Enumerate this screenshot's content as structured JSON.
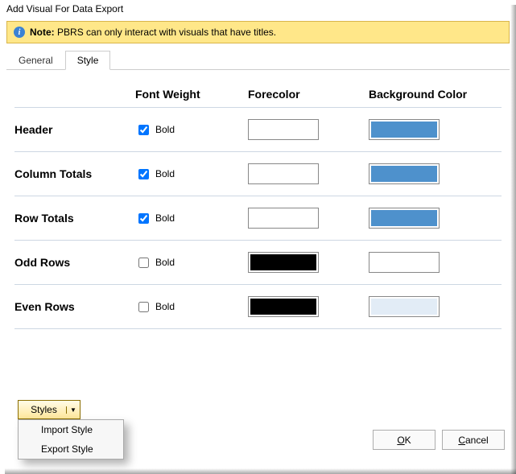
{
  "title": "Add Visual For Data Export",
  "note_label": "Note:",
  "note_text": "PBRS can only interact with visuals that have titles.",
  "tabs": {
    "general": "General",
    "style": "Style"
  },
  "headers": {
    "font_weight": "Font Weight",
    "forecolor": "Forecolor",
    "bgcolor": "Background Color"
  },
  "bold_label": "Bold",
  "rows": [
    {
      "label": "Header",
      "bold": true,
      "fore": "#ffffff",
      "bg": "#4e91cc"
    },
    {
      "label": "Column Totals",
      "bold": true,
      "fore": "#ffffff",
      "bg": "#4e91cc"
    },
    {
      "label": "Row Totals",
      "bold": true,
      "fore": "#ffffff",
      "bg": "#4e91cc"
    },
    {
      "label": "Odd Rows",
      "bold": false,
      "fore": "#000000",
      "bg": "#ffffff"
    },
    {
      "label": "Even Rows",
      "bold": false,
      "fore": "#000000",
      "bg": "#e2ecf6"
    }
  ],
  "styles_btn": "Styles",
  "menu": {
    "import": "Import Style",
    "export": "Export Style"
  },
  "buttons": {
    "ok": "OK",
    "cancel": "Cancel"
  }
}
